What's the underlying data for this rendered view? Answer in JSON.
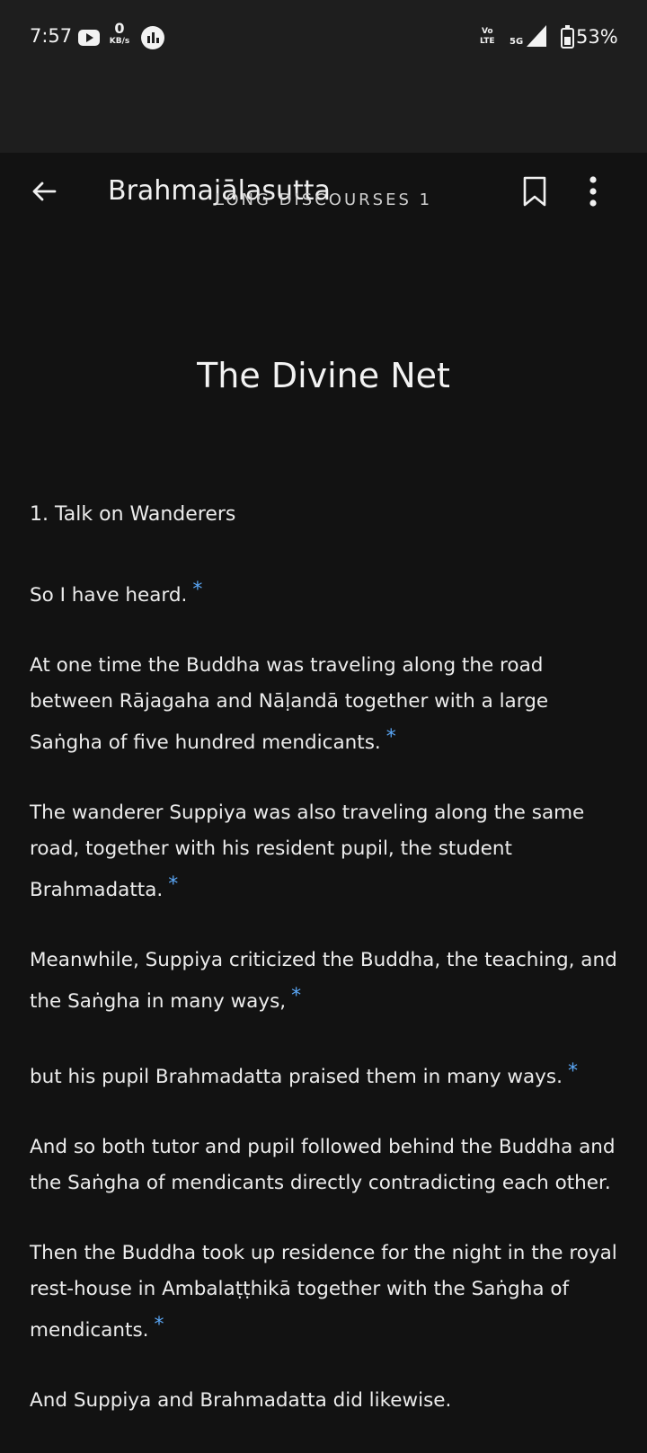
{
  "status_bar": {
    "time": "7:57",
    "network_speed_value": "0",
    "network_speed_unit": "KB/s",
    "volte_line1": "Vo",
    "volte_line2": "LTE",
    "network_type": "5G",
    "battery_percent": "53%"
  },
  "app_bar": {
    "title": "Brahmajālasutta"
  },
  "header": {
    "collection": "LONG DISCOURSES 1",
    "title": "The Divine Net"
  },
  "section_heading": "1. Talk on Wanderers",
  "paragraphs": [
    {
      "text": "So I have heard.",
      "note": "*"
    },
    {
      "text": "At one time the Buddha was traveling along the road between Rājagaha and Nāḷandā together with a large Saṅgha of five hundred mendicants.",
      "note": "*"
    },
    {
      "text": "The wanderer Suppiya was also traveling along the same road, together with his resident pupil, the student Brahmadatta.",
      "note": "*"
    },
    {
      "text": "Meanwhile, Suppiya criticized the Buddha, the teaching, and the Saṅgha in many ways,",
      "note": "*"
    },
    {
      "text": "but his pupil Brahmadatta praised them in many ways.",
      "note": "*"
    },
    {
      "text": "And so both tutor and pupil followed behind the Buddha and the Saṅgha of mendicants directly contradicting each other.",
      "note": ""
    },
    {
      "text": "Then the Buddha took up residence for the night in the royal rest-house in Ambalaṭṭhikā together with the Saṅgha of mendicants.",
      "note": "*"
    },
    {
      "text": "And Suppiya and Brahmadatta did likewise.",
      "note": ""
    }
  ],
  "colors": {
    "background": "#121212",
    "bar": "#1e1e1e",
    "text": "#ececec",
    "note_accent": "#5aa6f5"
  }
}
